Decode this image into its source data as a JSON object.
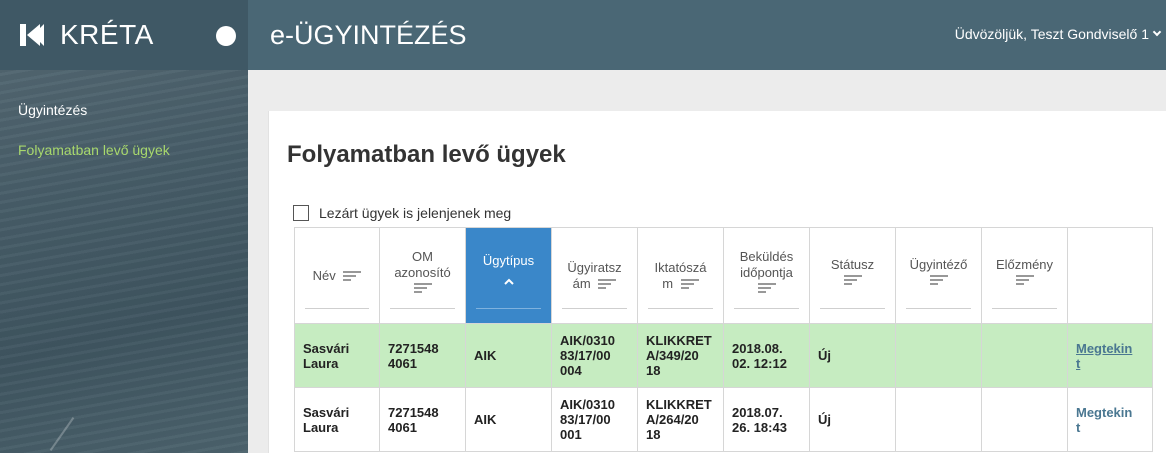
{
  "brand": {
    "name": "KRÉTA"
  },
  "topbar": {
    "title": "e-ÜGYINTÉZÉS",
    "user_greeting": "Üdvözöljük, Teszt Gondviselő 1"
  },
  "sidebar": {
    "items": [
      {
        "label": "Ügyintézés"
      },
      {
        "label": "Folyamatban levő ügyek"
      }
    ]
  },
  "main": {
    "title": "Folyamatban levő ügyek",
    "show_closed_label": "Lezárt ügyek is jelenjenek meg",
    "show_closed_checked": false
  },
  "table": {
    "columns": [
      {
        "lines": [
          "Név"
        ]
      },
      {
        "lines": [
          "OM",
          "azonosító"
        ]
      },
      {
        "lines": [
          "Ügytípus"
        ]
      },
      {
        "lines": [
          "Ügyiratsz",
          "ám"
        ]
      },
      {
        "lines": [
          "Iktatószá",
          "m"
        ]
      },
      {
        "lines": [
          "Beküldés",
          "időpontja"
        ]
      },
      {
        "lines": [
          "Státusz"
        ]
      },
      {
        "lines": [
          "Ügyintéző"
        ]
      },
      {
        "lines": [
          "Előzmény"
        ]
      },
      {
        "lines": [
          ""
        ]
      }
    ],
    "sorted_column": "Ügytípus",
    "rows": [
      {
        "nev": [
          "Sasvári",
          "Laura"
        ],
        "om": [
          "7271548",
          "4061"
        ],
        "ugytipus": "AIK",
        "ugyiratszam": [
          "AIK/0310",
          "83/17/00",
          "004"
        ],
        "iktatoszam": [
          "KLIKKRET",
          "A/349/20",
          "18"
        ],
        "bekuldes": [
          "2018.08.",
          "02. 12:12"
        ],
        "statusz": "Új",
        "ugyintezo": "",
        "elozmeny": "",
        "action": [
          "Megtekin",
          "t"
        ]
      },
      {
        "nev": [
          "Sasvári",
          "Laura"
        ],
        "om": [
          "7271548",
          "4061"
        ],
        "ugytipus": "AIK",
        "ugyiratszam": [
          "AIK/0310",
          "83/17/00",
          "001"
        ],
        "iktatoszam": [
          "KLIKKRET",
          "A/264/20",
          "18"
        ],
        "bekuldes": [
          "2018.07.",
          "26. 18:43"
        ],
        "statusz": "Új",
        "ugyintezo": "",
        "elozmeny": "",
        "action": [
          "Megtekin",
          "t"
        ]
      }
    ]
  },
  "colors": {
    "topbar": "#4a6775",
    "sidebar": "#475d68",
    "active_nav": "#a8d86d",
    "sorted_header": "#3a87c9",
    "highlight_row": "#c6ecc1",
    "link": "#4a7791"
  }
}
